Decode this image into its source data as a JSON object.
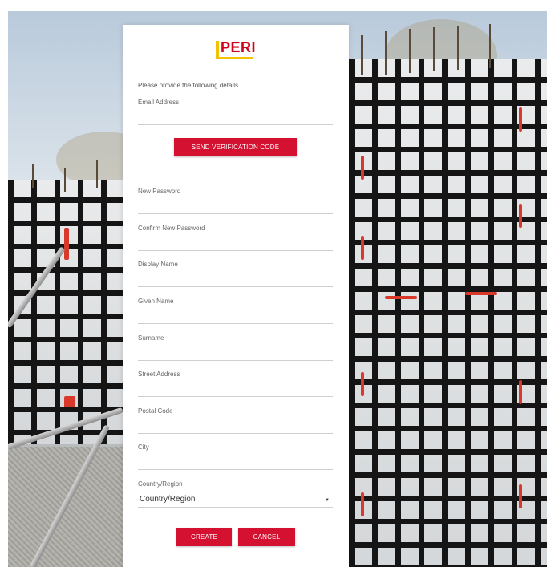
{
  "logo": {
    "text": "PERI"
  },
  "form": {
    "intro": "Please provide the following details.",
    "email_label": "Email Address",
    "send_code_button": "SEND VERIFICATION CODE",
    "new_password_label": "New Password",
    "confirm_password_label": "Confirm New Password",
    "display_name_label": "Display Name",
    "given_name_label": "Given Name",
    "surname_label": "Surname",
    "street_address_label": "Street Address",
    "postal_code_label": "Postal Code",
    "city_label": "City",
    "country_label": "Country/Region",
    "country_selected": "Country/Region",
    "create_button": "CREATE",
    "cancel_button": "CANCEL"
  },
  "colors": {
    "brand_red": "#d41130",
    "logo_yellow": "#f2c200"
  }
}
